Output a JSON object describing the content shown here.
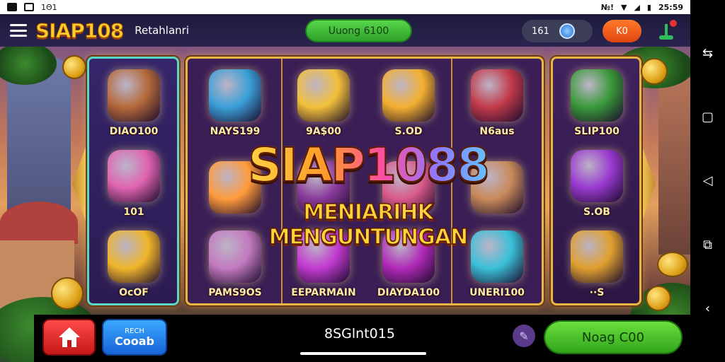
{
  "status_bar": {
    "left_icons": [
      "photo-icon",
      "notification-icon"
    ],
    "left_text": "1Θ1",
    "time": "25:59",
    "right_text": "№!"
  },
  "top_bar": {
    "logo": "SIAP108",
    "subtitle": "Retahlanri",
    "balance_button": "Uuong 6100",
    "coins": "161",
    "k_button": "K0"
  },
  "reels": {
    "left": [
      {
        "label": "DIAO100",
        "symbol_color": "#b56a3a"
      },
      {
        "label": "101",
        "symbol_color": "#e064b0"
      },
      {
        "label": "OcOF",
        "symbol_color": "#f0b52a"
      }
    ],
    "mid_col1": [
      {
        "label": "NAYS199",
        "symbol_color": "#3aa0d8"
      },
      {
        "label": "",
        "symbol_color": "#ff9a3a"
      },
      {
        "label": "PAMS9OS",
        "symbol_color": "#c27ac0"
      }
    ],
    "mid_col2": [
      {
        "label": "9A$00",
        "symbol_color": "#f3c03a"
      },
      {
        "label": "",
        "symbol_color": "#8a3a9a"
      },
      {
        "label": "EEPARMAIN",
        "symbol_color": "#c23ad0"
      }
    ],
    "mid_col3": [
      {
        "label": "S.OD",
        "symbol_color": "#f3b030"
      },
      {
        "label": "",
        "symbol_color": "#d85a8a"
      },
      {
        "label": "DIAYDA100",
        "symbol_color": "#b12ab8"
      }
    ],
    "mid_col4": [
      {
        "label": "N6aus",
        "symbol_color": "#c23a4a"
      },
      {
        "label": "",
        "symbol_color": "#c88a5a"
      },
      {
        "label": "UNERI100",
        "symbol_color": "#3ac0d8"
      }
    ],
    "right": [
      {
        "label": "SLIP100",
        "symbol_color": "#3a9a3a"
      },
      {
        "label": "S.OB",
        "symbol_color": "#9a3ad0"
      },
      {
        "label": "··S",
        "symbol_color": "#e0a030"
      }
    ]
  },
  "title": {
    "main": "SIAP1088",
    "sub": "MENIARIHK MENGUNTUNGAN"
  },
  "bottom_bar": {
    "coupon_top": "RECH",
    "coupon_main": "Cooab",
    "center_label": "8SGlnt015",
    "play_button": "Noag C00"
  },
  "colors": {
    "accent_gold": "#e8b545",
    "play_green": "#32a61c",
    "home_red": "#c51818",
    "coupon_blue": "#1864d8"
  }
}
